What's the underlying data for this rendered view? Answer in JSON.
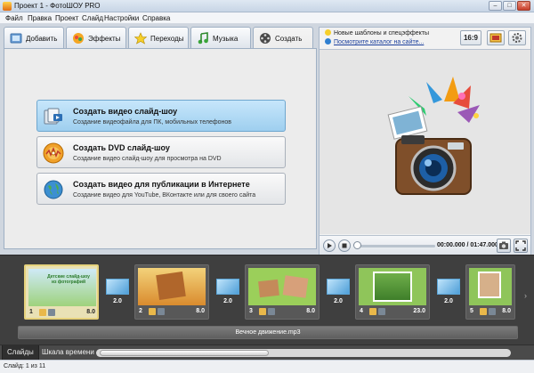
{
  "window": {
    "title": "Проект 1 - ФотоШОУ PRO",
    "controls": {
      "minimize": "–",
      "maximize": "□",
      "close": "✕"
    }
  },
  "menu": [
    "Файл",
    "Правка",
    "Проект",
    "Слайд",
    "Настройки",
    "Справка"
  ],
  "tabs": [
    {
      "label": "Добавить",
      "icon": "add-icon"
    },
    {
      "label": "Эффекты",
      "icon": "effects-icon"
    },
    {
      "label": "Переходы",
      "icon": "star-icon"
    },
    {
      "label": "Музыка",
      "icon": "music-icon"
    },
    {
      "label": "Создать",
      "icon": "film-reel-icon",
      "active": true
    }
  ],
  "create_options": [
    {
      "title": "Создать видео слайд-шоу",
      "desc": "Создание видеофайла для ПК, мобильных телефонов",
      "icon": "video-file-icon",
      "selected": true
    },
    {
      "title": "Создать DVD слайд-шоу",
      "desc": "Создание видео слайд-шоу для просмотра на DVD",
      "icon": "dvd-icon",
      "selected": false
    },
    {
      "title": "Создать видео для публикации в Интернете",
      "desc": "Создание видео для YouTube, ВКонтакте или для своего сайта",
      "icon": "globe-icon",
      "selected": false
    }
  ],
  "news": {
    "templates": "Новые шаблоны и спецэффекты",
    "catalog_link": "Посмотрите каталог на сайте..."
  },
  "aspect_ratio": "16:9",
  "player": {
    "time": "00:00.000 / 01:47.000"
  },
  "slides": [
    {
      "num": "1",
      "duration": "8.0",
      "selected": true,
      "thumb_text": "Детские слайд-шоу из фотографий"
    },
    {
      "num": "2",
      "duration": "8.0",
      "selected": false
    },
    {
      "num": "3",
      "duration": "8.0",
      "selected": false
    },
    {
      "num": "4",
      "duration": "23.0",
      "selected": false
    },
    {
      "num": "5",
      "duration": "8.0",
      "selected": false
    }
  ],
  "transitions": [
    "2.0",
    "2.0",
    "2.0",
    "2.0",
    "2.0"
  ],
  "music_track": "Вечное движение.mp3",
  "bottom_tabs": {
    "slides": "Слайды",
    "timeline": "Шкала времени"
  },
  "status": "Слайд: 1 из 11",
  "colors": {
    "accent_selected": "#9ecfef",
    "timeline_bg": "#3f3f3f",
    "slide_selected_border": "#e6d27c"
  }
}
